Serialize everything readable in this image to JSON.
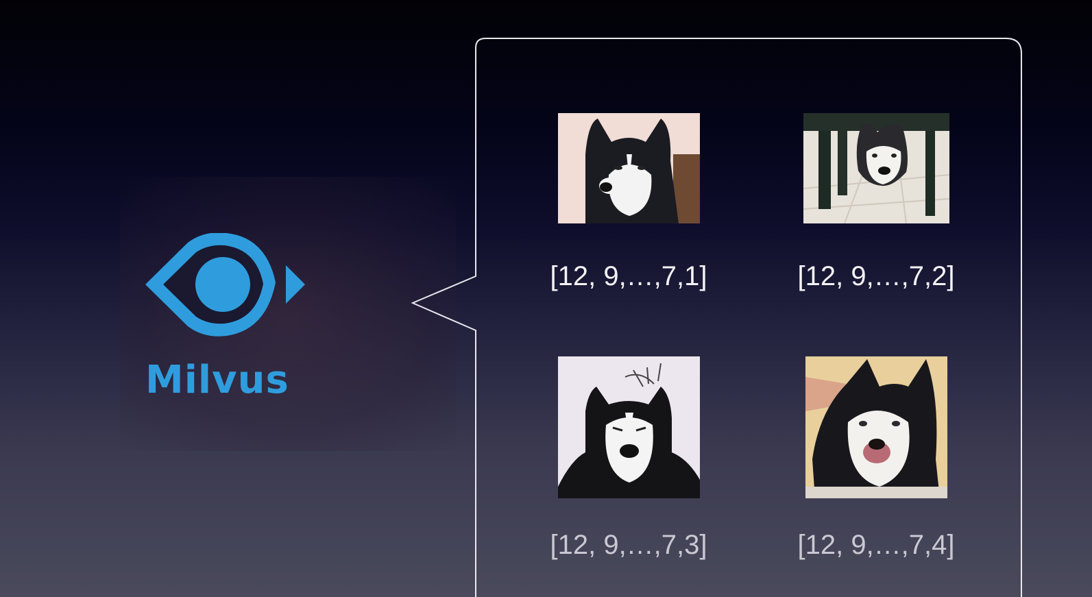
{
  "brand": {
    "name": "Milvus",
    "accent_color": "#2f9ddd",
    "icon": "milvus-eye-logo-icon"
  },
  "callout": {
    "stroke_color": "#e8e8ee",
    "items": [
      {
        "image_subject": "husky-dog-photo",
        "vector_label": "[12, 9,…,7,1]"
      },
      {
        "image_subject": "husky-dog-photo",
        "vector_label": "[12, 9,…,7,2]"
      },
      {
        "image_subject": "husky-dog-photo",
        "vector_label": "[12, 9,…,7,3]"
      },
      {
        "image_subject": "husky-dog-photo",
        "vector_label": "[12, 9,…,7,4]"
      }
    ]
  }
}
